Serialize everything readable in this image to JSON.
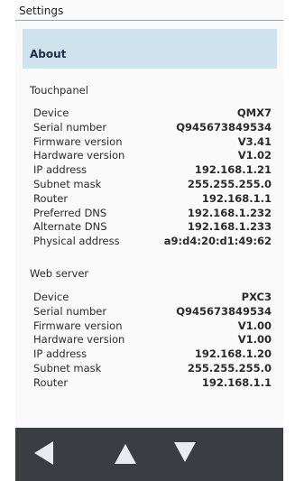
{
  "window": {
    "title": "Settings"
  },
  "about": {
    "label": "About"
  },
  "touchpanel": {
    "heading": "Touchpanel",
    "rows": [
      {
        "label": "Device",
        "value": "QMX7"
      },
      {
        "label": "Serial number",
        "value": "Q945673849534"
      },
      {
        "label": "Firmware version",
        "value": "V3.41"
      },
      {
        "label": "Hardware version",
        "value": "V1.02"
      },
      {
        "label": "IP address",
        "value": "192.168.1.21"
      },
      {
        "label": "Subnet mask",
        "value": "255.255.255.0"
      },
      {
        "label": "Router",
        "value": "192.168.1.1"
      },
      {
        "label": "Preferred DNS",
        "value": "192.168.1.232"
      },
      {
        "label": "Alternate DNS",
        "value": "192.168.1.233"
      },
      {
        "label": "Physical address",
        "value": "a9:d4:20:d1:49:62"
      }
    ]
  },
  "webserver": {
    "heading": "Web server",
    "rows": [
      {
        "label": "Device",
        "value": "PXC3"
      },
      {
        "label": "Serial number",
        "value": "Q945673849534"
      },
      {
        "label": "Firmware version",
        "value": "V1.00"
      },
      {
        "label": "Hardware version",
        "value": "V1.00"
      },
      {
        "label": "IP address",
        "value": "192.168.1.20"
      },
      {
        "label": "Subnet mask",
        "value": "255.255.255.0"
      },
      {
        "label": "Router",
        "value": "192.168.1.1"
      }
    ]
  },
  "navigation": {
    "buttons": [
      {
        "name": "back-button",
        "icon": "back-arrow-icon"
      },
      {
        "name": "scroll-up-button",
        "icon": "up-arrow-icon"
      },
      {
        "name": "scroll-down-button",
        "icon": "down-arrow-icon"
      }
    ]
  },
  "colors": {
    "header_bar": "#cfe3ef",
    "nav_bar": "#3a3d42",
    "nav_icon": "#e8ecef"
  }
}
